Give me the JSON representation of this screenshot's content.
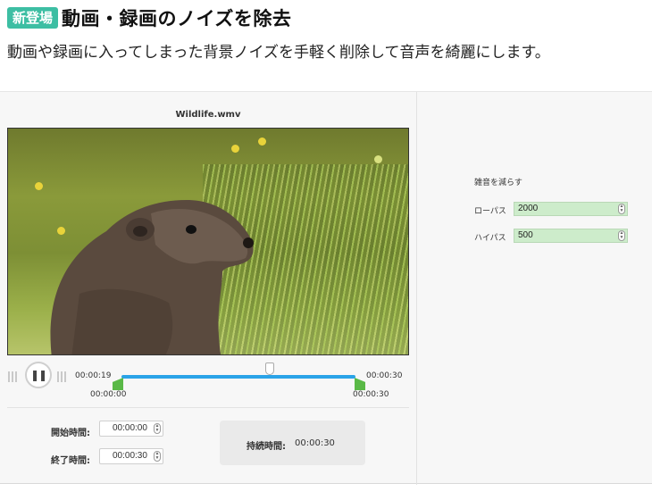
{
  "header": {
    "badge": "新登場",
    "title": "動画・録画のノイズを除去",
    "subtitle": "動画や録画に入ってしまった背景ノイズを手軽く削除して音声を綺麗にします。"
  },
  "player": {
    "file_name": "Wildlife.wmv",
    "current_time": "00:00:19",
    "total_time": "00:00:30",
    "range_start": "00:00:00",
    "range_end": "00:00:30",
    "playhead_fraction": 0.633,
    "play_state_icon": "pause-icon"
  },
  "trim": {
    "start_label": "開始時間:",
    "start_value": "00:00:00",
    "end_label": "終了時間:",
    "end_value": "00:00:30",
    "duration_label": "持続時間:",
    "duration_value": "00:00:30"
  },
  "settings": {
    "title": "雑音を減らす",
    "lowpass_label": "ローパス",
    "lowpass_value": "2000",
    "highpass_label": "ハイパス",
    "highpass_value": "500"
  },
  "colors": {
    "badge": "#3dbea3",
    "track": "#2aa3e8",
    "handle": "#5ab947",
    "input_bg": "#cdeccb"
  }
}
